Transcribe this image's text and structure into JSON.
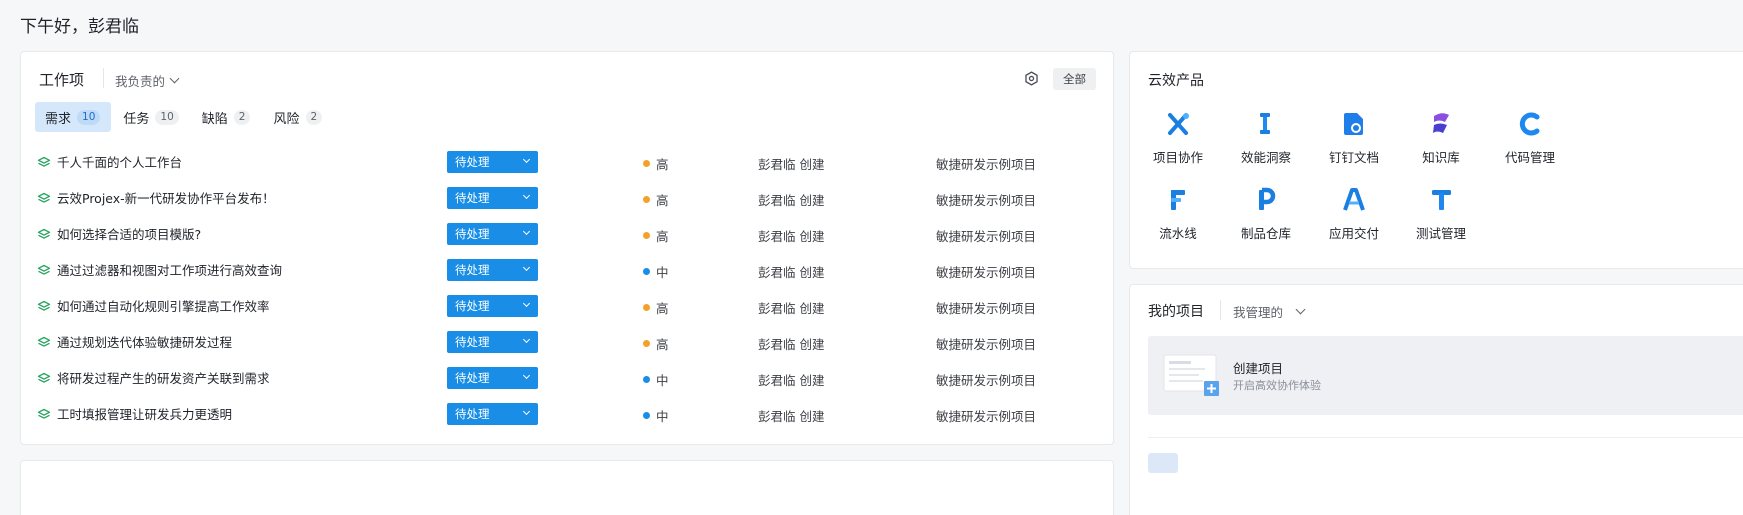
{
  "greeting": "下午好，彭君临",
  "work": {
    "title": "工作项",
    "filter": "我负责的",
    "all_label": "全部",
    "tabs": [
      {
        "label": "需求",
        "count": "10",
        "active": true
      },
      {
        "label": "任务",
        "count": "10",
        "active": false
      },
      {
        "label": "缺陷",
        "count": "2",
        "active": false
      },
      {
        "label": "风险",
        "count": "2",
        "active": false
      }
    ],
    "rows": [
      {
        "title": "千人千面的个人工作台",
        "status": "待处理",
        "priority": "高",
        "creator": "彭君临 创建",
        "project": "敏捷研发示例项目"
      },
      {
        "title": "云效Projex-新一代研发协作平台发布！",
        "status": "待处理",
        "priority": "高",
        "creator": "彭君临 创建",
        "project": "敏捷研发示例项目"
      },
      {
        "title": "如何选择合适的项目模版?",
        "status": "待处理",
        "priority": "高",
        "creator": "彭君临 创建",
        "project": "敏捷研发示例项目"
      },
      {
        "title": "通过过滤器和视图对工作项进行高效查询",
        "status": "待处理",
        "priority": "中",
        "creator": "彭君临 创建",
        "project": "敏捷研发示例项目"
      },
      {
        "title": "如何通过自动化规则引擎提高工作效率",
        "status": "待处理",
        "priority": "高",
        "creator": "彭君临 创建",
        "project": "敏捷研发示例项目"
      },
      {
        "title": "通过规划迭代体验敏捷研发过程",
        "status": "待处理",
        "priority": "高",
        "creator": "彭君临 创建",
        "project": "敏捷研发示例项目"
      },
      {
        "title": "将研发过程产生的研发资产关联到需求",
        "status": "待处理",
        "priority": "中",
        "creator": "彭君临 创建",
        "project": "敏捷研发示例项目"
      },
      {
        "title": "工时填报管理让研发兵力更透明",
        "status": "待处理",
        "priority": "中",
        "creator": "彭君临 创建",
        "project": "敏捷研发示例项目"
      }
    ],
    "priority_colors": {
      "高": "#f6a02c",
      "中": "#1a8ee6"
    }
  },
  "products": {
    "title": "云效产品",
    "items": [
      {
        "label": "项目协作",
        "icon": "projex-icon"
      },
      {
        "label": "效能洞察",
        "icon": "insight-icon"
      },
      {
        "label": "钉钉文档",
        "icon": "dingtalk-doc-icon"
      },
      {
        "label": "知识库",
        "icon": "knowledge-base-icon"
      },
      {
        "label": "代码管理",
        "icon": "codeup-icon"
      },
      {
        "label": "流水线",
        "icon": "flow-icon"
      },
      {
        "label": "制品仓库",
        "icon": "packages-icon"
      },
      {
        "label": "应用交付",
        "icon": "appstack-icon"
      },
      {
        "label": "测试管理",
        "icon": "testhub-icon"
      }
    ]
  },
  "my_projects": {
    "title": "我的项目",
    "filter": "我管理的",
    "create_title": "创建项目",
    "create_sub": "开启高效协作体验"
  }
}
